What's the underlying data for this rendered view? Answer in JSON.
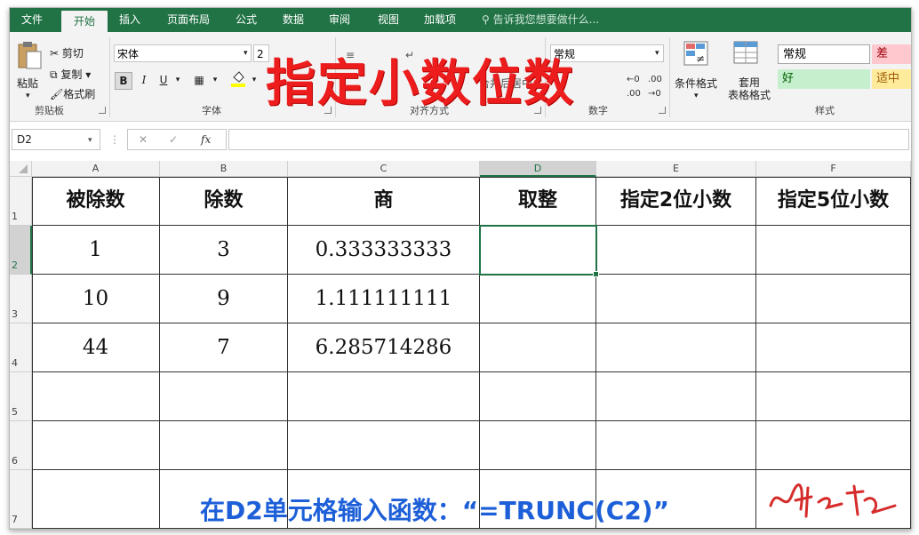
{
  "tabs": [
    {
      "label": "文件",
      "active": false
    },
    {
      "label": "开始",
      "active": true
    },
    {
      "label": "插入",
      "active": false
    },
    {
      "label": "页面布局",
      "active": false
    },
    {
      "label": "公式",
      "active": false
    },
    {
      "label": "数据",
      "active": false
    },
    {
      "label": "审阅",
      "active": false
    },
    {
      "label": "视图",
      "active": false
    },
    {
      "label": "加载项",
      "active": false
    }
  ],
  "tell_me": "告诉我您想要做什么...",
  "clipboard": {
    "paste": "粘贴",
    "cut": "剪切",
    "copy": "复制",
    "painter": "格式刷",
    "label": "剪贴板"
  },
  "font": {
    "name": "宋体",
    "size": "2",
    "label": "字体",
    "bold": "B",
    "italic": "I",
    "underline": "U"
  },
  "alignment": {
    "label": "对齐方式",
    "merge": "合并后居中"
  },
  "number": {
    "format": "常规",
    "label": "数字"
  },
  "styles": {
    "conditional": "条件格式",
    "table_format": "套用\n表格格式",
    "label": "样式",
    "normal": "常规",
    "bad": "差",
    "good": "好",
    "neutral": "适中",
    "colors": {
      "bad_bg": "#ffc7ce",
      "bad_fg": "#9c0006",
      "good_bg": "#c6efce",
      "good_fg": "#006100",
      "neutral_bg": "#ffeb9c",
      "neutral_fg": "#9c5700"
    }
  },
  "name_box": "D2",
  "formula_icons": {
    "cancel": "✕",
    "enter": "✓",
    "fx": "fx"
  },
  "columns": [
    "A",
    "B",
    "C",
    "D",
    "E",
    "F"
  ],
  "rows": [
    "1",
    "2",
    "3",
    "4",
    "5",
    "6",
    "7"
  ],
  "table": {
    "headers": [
      "被除数",
      "除数",
      "商",
      "取整",
      "指定2位小数",
      "指定5位小数"
    ],
    "data": [
      [
        "1",
        "3",
        "0.333333333",
        "",
        "",
        ""
      ],
      [
        "10",
        "9",
        "1.111111111",
        "",
        "",
        ""
      ],
      [
        "44",
        "7",
        "6.285714286",
        "",
        "",
        ""
      ],
      [
        "",
        "",
        "",
        "",
        "",
        ""
      ],
      [
        "",
        "",
        "",
        "",
        "",
        ""
      ],
      [
        "",
        "",
        "",
        "",
        "",
        ""
      ]
    ]
  },
  "overlay_title": "指定小数位数",
  "overlay_note": "在D2单元格输入函数：“=TRUNC(C2)”",
  "accent": "#217346"
}
